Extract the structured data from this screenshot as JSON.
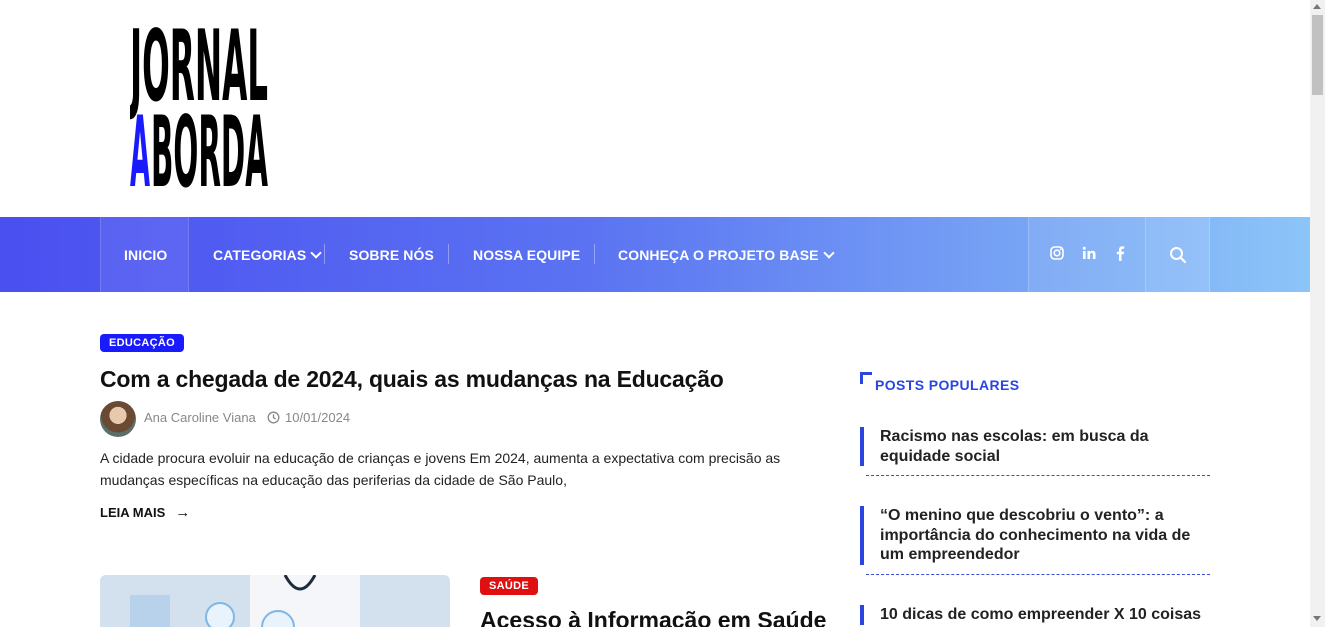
{
  "logo": {
    "line1": "JORNAL",
    "line2_accent": "A",
    "line2_rest": "BORDA",
    "accent_color": "#1a1aff"
  },
  "nav": {
    "items": [
      {
        "label": "INICIO"
      },
      {
        "label": "CATEGORIAS",
        "dropdown": true
      },
      {
        "label": "SOBRE NÓS"
      },
      {
        "label": "NOSSA EQUIPE"
      },
      {
        "label": "CONHEÇA O PROJETO BASE",
        "dropdown": true
      }
    ],
    "social": [
      "instagram-icon",
      "linkedin-icon",
      "facebook-icon"
    ],
    "search_icon": "search-icon"
  },
  "featured": {
    "category": "EDUCAÇÃO",
    "category_color": "#1a1aff",
    "title": "Com a chegada de 2024, quais as mudanças na Educação",
    "author": "Ana Caroline Viana",
    "date": "10/01/2024",
    "excerpt": "A cidade procura evoluir na educação de crianças e jovens Em 2024, aumenta a expectativa com precisão as mudanças específicas na educação das periferias da cidade de São Paulo,",
    "read_more": "LEIA MAIS"
  },
  "second": {
    "category": "SAÚDE",
    "category_color": "#e01010",
    "title": "Acesso à Informação em Saúde"
  },
  "sidebar": {
    "title": "POSTS POPULARES",
    "posts": [
      "Racismo nas escolas: em busca da equidade social",
      "“O menino que descobriu o vento”: a importância do conhecimento na vida de um empreendedor",
      "10 dicas de como empreender X 10 coisas"
    ]
  }
}
